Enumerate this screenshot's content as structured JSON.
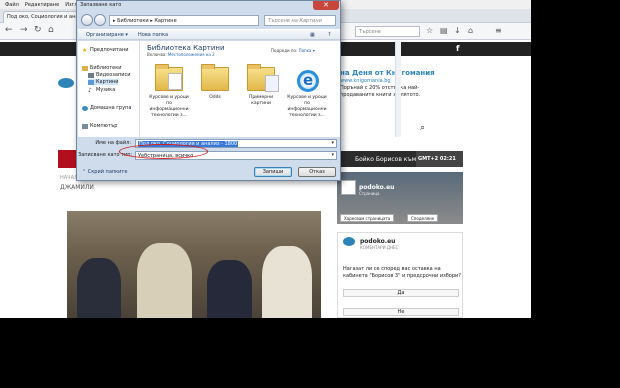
{
  "browser": {
    "menu": [
      "Файл",
      "Редактиране",
      "Изглед"
    ],
    "tab_title": "Под око, Социология и анализ",
    "url_placeholder": "Търсене",
    "social_icon": "f"
  },
  "page": {
    "promo": {
      "title": "на Деня от Книгомания",
      "url": "www.knigomania.bg",
      "text": "Порънай с 20% отстъпка най-продаваните книги за лятото."
    },
    "sidebar_bar_text": "Бойко Борисов към",
    "gmt": "GMT+2 02:21",
    "breadcrumb": "НАЧАЛО",
    "category": "ДЖАМИЛИ",
    "fb": {
      "name": "podoko.eu",
      "sub": "Страница",
      "like": "Харесвам страницата",
      "share": "Споделяне"
    },
    "poll": {
      "name": "podoko.eu",
      "sub": "КОМЕНТАРИ ДНЕС",
      "question": "Нагазат ли се спорeд вас  оставка на кабинета \"Борисов 3\" и предсрочни избори?",
      "options": [
        "Да",
        "Не"
      ]
    }
  },
  "dialog": {
    "title": "Запазване като",
    "close": "✕",
    "address": [
      "Библиотеки",
      "Картине"
    ],
    "search_placeholder": "Търсене на Картини",
    "toolbar": {
      "organize": "Организиране ▾",
      "new_folder": "Нова папка"
    },
    "nav": {
      "favorites": "Предпочитани",
      "libraries": "Библиотеки",
      "videos": "Видеозаписи",
      "pictures": "Картини",
      "music": "Музика",
      "homegroup": "Домашна група",
      "computer": "Компютър"
    },
    "library_title": "Библиотека Картини",
    "library_sub_prefix": "Включва:",
    "library_sub_link": "Местоположения на 2",
    "arrange_prefix": "Подреди по:",
    "arrange_value": "Папка ▾",
    "folders": [
      {
        "label": "Курсове и уроци по информационни технологии з..."
      },
      {
        "label": "Odds"
      },
      {
        "label": "Примерни картини"
      },
      {
        "label": "Курсове и уроци по информационни технологии з..."
      }
    ],
    "file_name_label": "Име на файл:",
    "file_name_value": "Под око, Социология и анализ - 1800",
    "save_type_label": "Записване като тип:",
    "save_type_value": "Уебстраница, всичко",
    "hide_folders": "Скрий папките",
    "save_button": "Запиши",
    "cancel_button": "Отказ"
  }
}
